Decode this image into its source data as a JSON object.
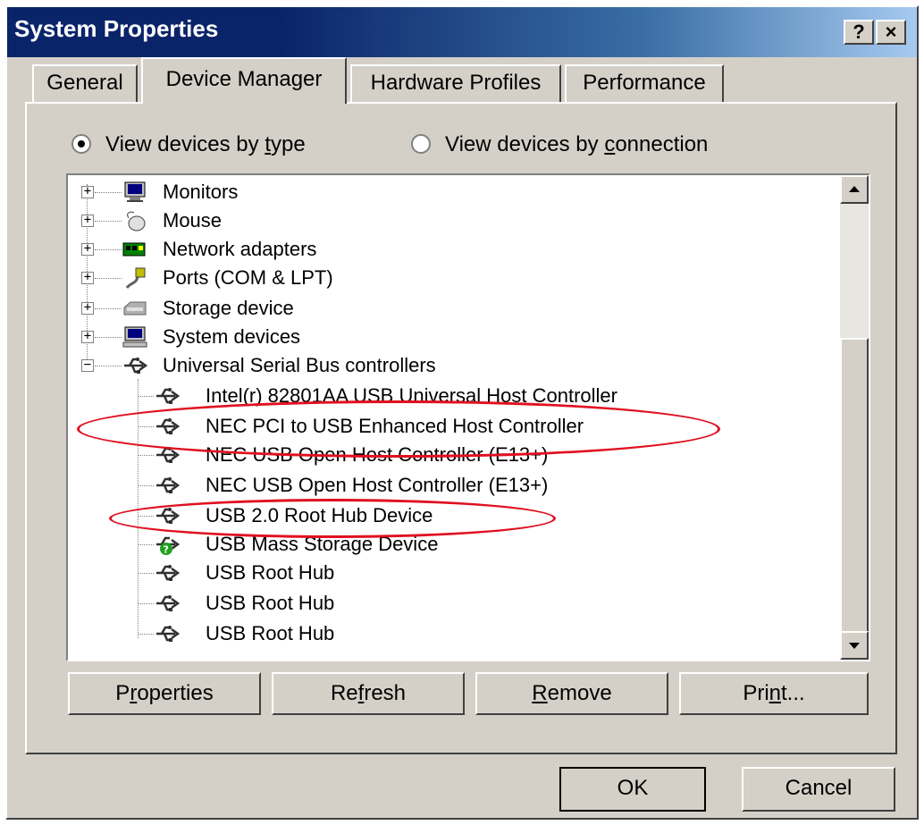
{
  "window": {
    "title": "System Properties",
    "help_btn": "?",
    "close_btn": "×"
  },
  "tabs": [
    {
      "label": "General"
    },
    {
      "label": "Device Manager"
    },
    {
      "label": "Hardware Profiles"
    },
    {
      "label": "Performance"
    }
  ],
  "view_options": {
    "by_type": {
      "label_pre": "View devices by ",
      "label_u": "t",
      "label_post": "ype",
      "selected": true
    },
    "by_connection": {
      "label_pre": "View devices by ",
      "label_u": "c",
      "label_post": "onnection",
      "selected": false
    }
  },
  "tree": {
    "categories": [
      {
        "label": "Monitors",
        "icon": "monitor-icon",
        "expanded": false
      },
      {
        "label": "Mouse",
        "icon": "mouse-icon",
        "expanded": false
      },
      {
        "label": "Network adapters",
        "icon": "network-adapter-icon",
        "expanded": false
      },
      {
        "label": "Ports (COM & LPT)",
        "icon": "port-icon",
        "expanded": false
      },
      {
        "label": "Storage device",
        "icon": "storage-icon",
        "expanded": false
      },
      {
        "label": "System devices",
        "icon": "computer-icon",
        "expanded": false
      },
      {
        "label": "Universal Serial Bus controllers",
        "icon": "usb-icon",
        "expanded": true
      }
    ],
    "usb_children": [
      {
        "label": "Intel(r) 82801AA USB Universal Host Controller",
        "icon": "usb-icon"
      },
      {
        "label": "NEC PCI to USB Enhanced Host Controller",
        "icon": "usb-icon"
      },
      {
        "label": "NEC USB Open Host Controller (E13+)",
        "icon": "usb-icon"
      },
      {
        "label": "NEC USB Open Host Controller (E13+)",
        "icon": "usb-icon"
      },
      {
        "label": "USB 2.0 Root Hub Device",
        "icon": "usb-icon"
      },
      {
        "label": "USB Mass Storage Device",
        "icon": "usb-question-icon"
      },
      {
        "label": "USB Root Hub",
        "icon": "usb-icon"
      },
      {
        "label": "USB Root Hub",
        "icon": "usb-icon"
      },
      {
        "label": "USB Root Hub",
        "icon": "usb-icon"
      }
    ]
  },
  "buttons": {
    "properties": {
      "pre": "P",
      "u": "r",
      "post": "operties"
    },
    "refresh": {
      "pre": "Re",
      "u": "f",
      "post": "resh"
    },
    "remove": {
      "pre": "",
      "u": "R",
      "post": "emove"
    },
    "print": {
      "pre": "Pri",
      "u": "n",
      "post": "t..."
    },
    "ok": "OK",
    "cancel": "Cancel"
  },
  "colors": {
    "annotation": "#e01020",
    "titlebar": "#0a246a",
    "face": "#d4d0c8"
  }
}
